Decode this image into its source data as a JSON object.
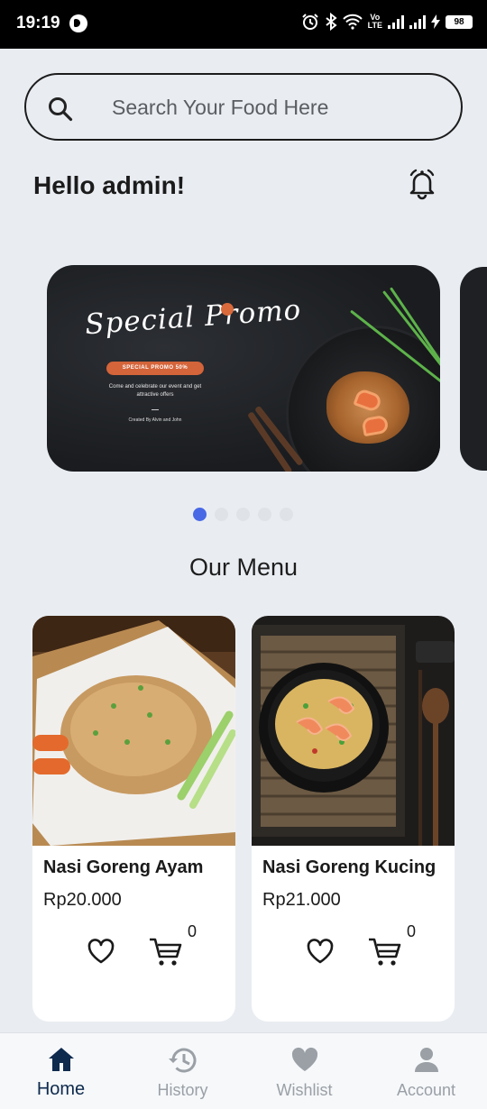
{
  "status_bar": {
    "time": "19:19",
    "network": "Vo\nLTE",
    "battery": "98",
    "icons": [
      "alarm-icon",
      "bluetooth-icon",
      "wifi-icon",
      "signal-icon",
      "charging-icon",
      "battery-icon"
    ]
  },
  "search": {
    "placeholder": "Search Your Food Here",
    "value": ""
  },
  "greeting": "Hello admin!",
  "banner": {
    "title": "Special Promo",
    "pill": "SPECIAL PROMO 50%",
    "description": "Come and celebrate our event and get attractive offers",
    "credit": "Created By Alvin and John"
  },
  "carousel": {
    "total": 5,
    "active_index": 0
  },
  "section_title": "Our Menu",
  "menu": [
    {
      "name": "Nasi Goreng Ayam",
      "price": "Rp20.000",
      "cart_count": "0"
    },
    {
      "name": "Nasi Goreng Kucing",
      "price": "Rp21.000",
      "cart_count": "0"
    }
  ],
  "nav": {
    "items": [
      {
        "label": "Home",
        "icon": "home-icon",
        "active": true
      },
      {
        "label": "History",
        "icon": "history-icon",
        "active": false
      },
      {
        "label": "Wishlist",
        "icon": "heart-icon",
        "active": false
      },
      {
        "label": "Account",
        "icon": "account-icon",
        "active": false
      }
    ]
  },
  "colors": {
    "background": "#e9edf2",
    "accent": "#4868e6",
    "promo": "#d4643a",
    "nav_active": "#0e2a4d"
  }
}
